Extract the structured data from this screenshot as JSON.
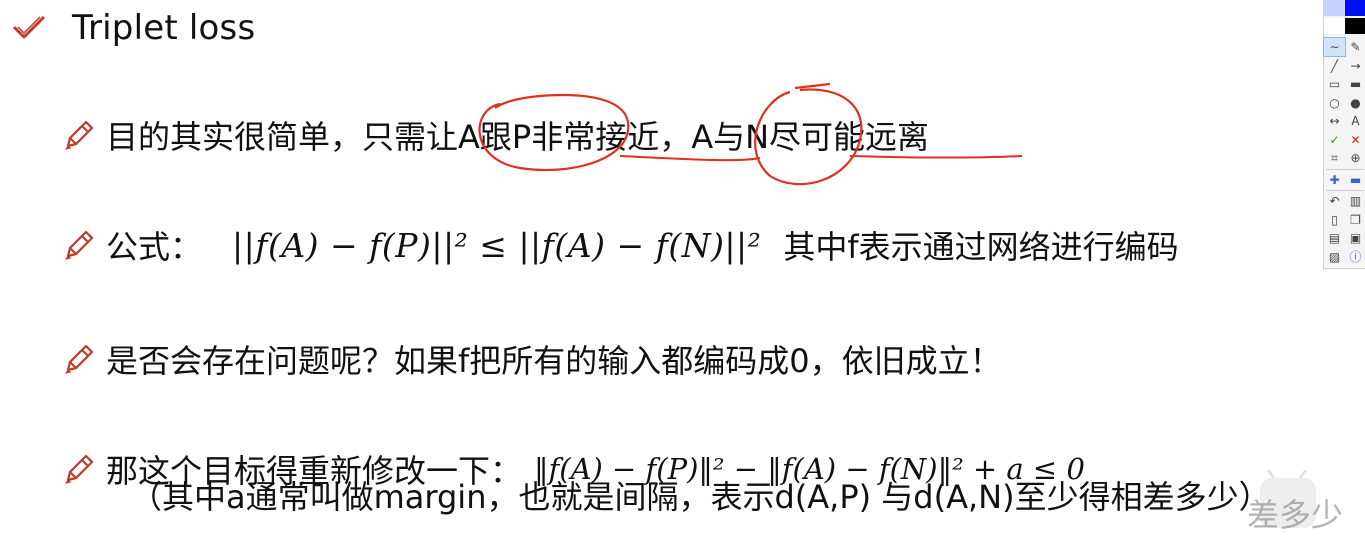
{
  "slide": {
    "title": "Triplet loss",
    "bullets": [
      {
        "text": "目的其实很简单，只需让A跟P非常接近，A与N尽可能远离"
      },
      {
        "prefix": "公式：",
        "formula": "||f(A) − f(P)||² ≤ ||f(A) − f(N)||²",
        "suffix": "其中f表示通过网络进行编码"
      },
      {
        "text": "是否会存在问题呢？如果f把所有的输入都编码成0，依旧成立！"
      },
      {
        "prefix": "那这个目标得重新修改一下：",
        "formula": "‖f(A) − f(P)‖² − ‖f(A) − f(N)‖² + a ≤ 0",
        "line2": "（其中a通常叫做margin，也就是间隔，表示d(A,P) 与d(A,N)至少得相差多少）"
      }
    ]
  },
  "colors": {
    "annotation": "#e0301e",
    "icon": "#c0392b"
  },
  "toolbar": {
    "tools": [
      [
        "freehand-pen",
        "eraser"
      ],
      [
        "line",
        "arrow"
      ],
      [
        "rectangle",
        "filled-rectangle"
      ],
      [
        "ellipse",
        "filled-ellipse"
      ],
      [
        "double-arrow",
        "text"
      ],
      [
        "confirm",
        "cancel"
      ],
      [
        "crop",
        "zoom"
      ],
      [
        "add",
        "remove"
      ],
      [
        "undo",
        "delete"
      ],
      [
        "new-page",
        "copy"
      ],
      [
        "print",
        "save"
      ],
      [
        "image",
        "info"
      ]
    ]
  },
  "watermark": {
    "text": "差多少"
  }
}
